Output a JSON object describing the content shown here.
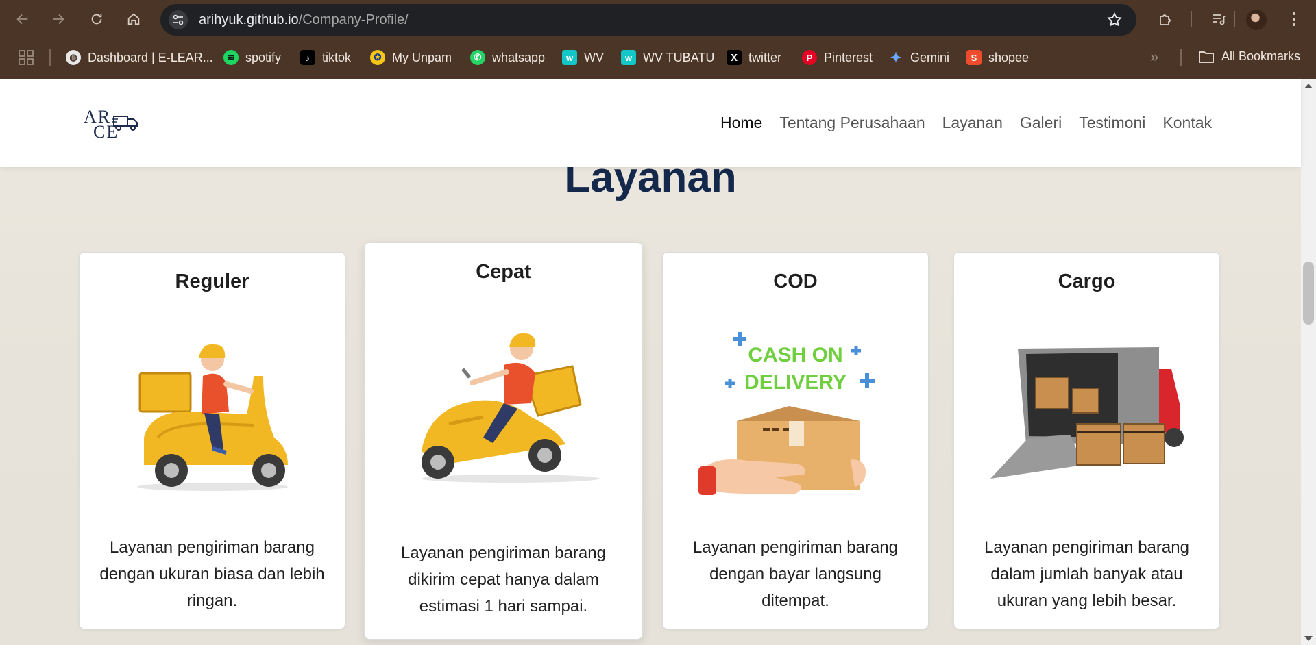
{
  "browser": {
    "url_host": "arihyuk.github.io",
    "url_path": "/Company-Profile/",
    "bookmarks": [
      {
        "label": "Dashboard | E-LEAR...",
        "icon": "globe-icon"
      },
      {
        "label": "spotify",
        "icon": "spotify-icon"
      },
      {
        "label": "tiktok",
        "icon": "tiktok-icon"
      },
      {
        "label": "My Unpam",
        "icon": "unpam-icon"
      },
      {
        "label": "whatsapp",
        "icon": "whatsapp-icon"
      },
      {
        "label": "WV",
        "icon": "wv-icon"
      },
      {
        "label": "WV TUBATU",
        "icon": "wv-icon"
      },
      {
        "label": "twitter",
        "icon": "x-icon"
      },
      {
        "label": "Pinterest",
        "icon": "pinterest-icon"
      },
      {
        "label": "Gemini",
        "icon": "gemini-icon"
      },
      {
        "label": "shopee",
        "icon": "shopee-icon"
      }
    ],
    "all_bookmarks": "All Bookmarks"
  },
  "site": {
    "logo_line1": "AR",
    "logo_line2": "CE",
    "nav": [
      "Home",
      "Tentang Perusahaan",
      "Layanan",
      "Galeri",
      "Testimoni",
      "Kontak"
    ],
    "active_nav": "Home"
  },
  "services": {
    "title": "Layanan",
    "cards": [
      {
        "title": "Reguler",
        "desc": "Layanan pengiriman barang dengan ukuran biasa dan lebih ringan.",
        "image": "scooter-courier-illustration"
      },
      {
        "title": "Cepat",
        "desc": "Layanan pengiriman barang dikirim cepat hanya dalam estimasi 1 hari sampai.",
        "image": "fast-scooter-courier-illustration"
      },
      {
        "title": "COD",
        "desc": "Layanan pengiriman barang dengan bayar langsung ditempat.",
        "image": "cash-on-delivery-illustration",
        "image_text_1": "CASH ON",
        "image_text_2": "DELIVERY"
      },
      {
        "title": "Cargo",
        "desc": "Layanan pengiriman barang dalam jumlah banyak atau ukuran yang lebih besar.",
        "image": "cargo-truck-illustration"
      }
    ]
  },
  "colors": {
    "chrome": "#4a3526",
    "omnibox": "#202124",
    "title": "#14284b",
    "cod_green": "#6fcf3f",
    "courier_orange": "#e8512c",
    "scooter_yellow": "#f2b824"
  }
}
